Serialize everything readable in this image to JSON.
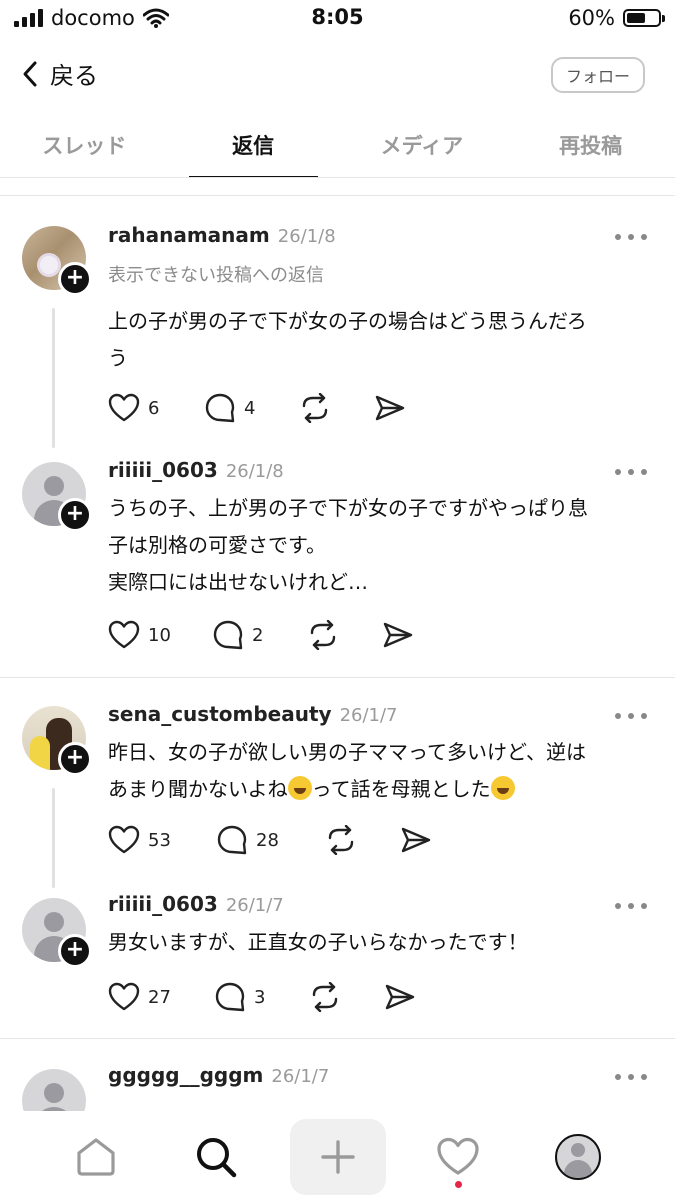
{
  "status_bar": {
    "carrier": "docomo",
    "time": "8:05",
    "battery": "60%",
    "battery_level": 0.6
  },
  "nav": {
    "back_label": "戻る",
    "follow_label": "フォロー"
  },
  "tabs": [
    {
      "label": "スレッド",
      "active": false
    },
    {
      "label": "返信",
      "active": true
    },
    {
      "label": "メディア",
      "active": false
    },
    {
      "label": "再投稿",
      "active": false
    }
  ],
  "posts": [
    {
      "username": "rahanamanam",
      "date": "26/1/8",
      "note": "表示できない投稿への返信",
      "text_lines": [
        "上の子が男の子で下が女の子の場合はどう思うんだろ",
        "う"
      ],
      "likes": "6",
      "replies": "4"
    },
    {
      "username": "riiiii_0603",
      "date": "26/1/8",
      "text_lines": [
        "うちの子、上が男の子で下が女の子ですがやっぱり息",
        "子は別格の可愛さです。",
        "実際口には出せないけれど…"
      ],
      "likes": "10",
      "replies": "2"
    },
    {
      "username": "sena_custombeauty",
      "date": "26/1/7",
      "text_line1": "昨日、女の子が欲しい男の子ママって多いけど、逆は",
      "text_line2a": "あまり聞かないよね",
      "text_line2b": "って話を母親とした",
      "likes": "53",
      "replies": "28"
    },
    {
      "username": "riiiii_0603",
      "date": "26/1/7",
      "text_lines": [
        "男女いますが、正直女の子いらなかったです！"
      ],
      "likes": "27",
      "replies": "3"
    },
    {
      "username": "ggggg__gggm",
      "date": "26/1/7"
    }
  ],
  "bottom_nav": [
    "home-icon",
    "search-icon",
    "compose-icon",
    "activity-icon",
    "profile-icon"
  ],
  "colors": {
    "notification_dot": "#e5264a",
    "text": "#111111",
    "muted": "#9a9a9a"
  }
}
